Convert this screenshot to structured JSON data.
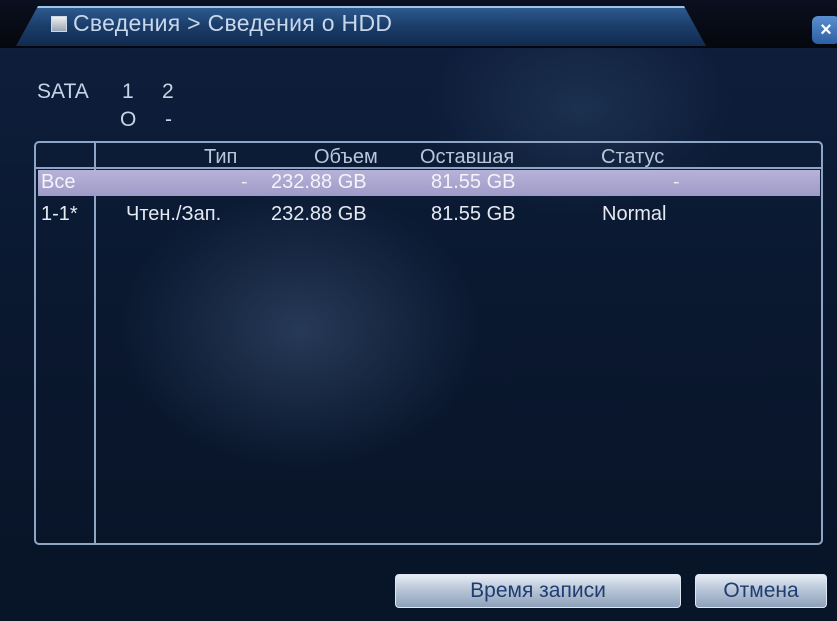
{
  "window": {
    "title": "Сведения > Сведения о HDD",
    "close_glyph": "×"
  },
  "sata": {
    "label": "SATA",
    "ports": [
      "1",
      "2"
    ],
    "statuses": [
      "O",
      "-"
    ]
  },
  "table": {
    "columns": [
      "Тип",
      "Объем",
      "Оставшая",
      "Статус"
    ],
    "rows": [
      {
        "id": "Все",
        "type": "-",
        "capacity": "232.88 GB",
        "remaining": "81.55 GB",
        "status": "-",
        "selected": true
      },
      {
        "id": "1-1*",
        "type": "Чтен./Зап.",
        "capacity": "232.88 GB",
        "remaining": "81.55 GB",
        "status": "Normal",
        "selected": false
      }
    ]
  },
  "buttons": {
    "record_time": "Время записи",
    "cancel": "Отмена"
  },
  "icons": {
    "title": "hdd-info-icon",
    "close": "close-icon"
  },
  "colors": {
    "selected_row": "#a9a6d0",
    "border": "#8fa5c5",
    "title_tab": "#1b3d6a"
  }
}
